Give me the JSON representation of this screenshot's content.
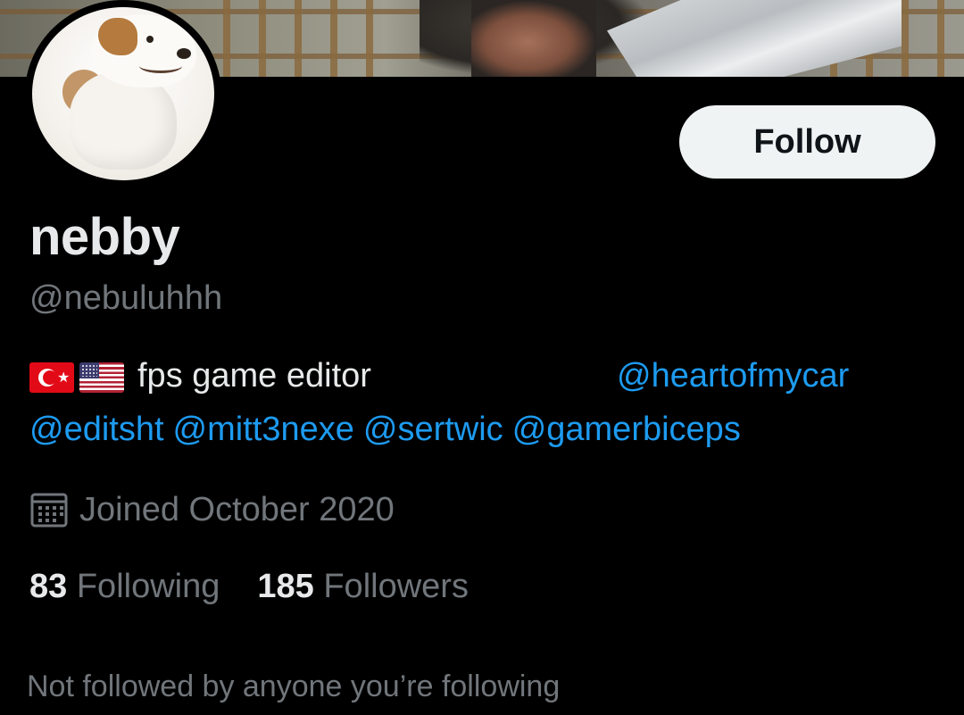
{
  "profile": {
    "display_name": "nebby",
    "handle": "@nebuluhhh",
    "follow_label": "Follow",
    "bio": {
      "flags": [
        "flag-turkey-icon",
        "flag-us-icon"
      ],
      "text": "fps game editor",
      "mentions_line1": [
        "@heartofmycar"
      ],
      "mentions_line2": [
        "@editsht",
        "@mitt3nexe",
        "@sertwic",
        "@gamerbiceps"
      ]
    },
    "joined": "Joined October 2020",
    "following_count": "83",
    "following_label": "Following",
    "followers_count": "185",
    "followers_label": "Followers",
    "mutuals_note": "Not followed by anyone you’re following"
  },
  "colors": {
    "background": "#000000",
    "text_primary": "#e7e9ea",
    "text_secondary": "#71767b",
    "link": "#1d9bf0",
    "button_bg": "#eff3f4",
    "button_text": "#0f1419"
  }
}
